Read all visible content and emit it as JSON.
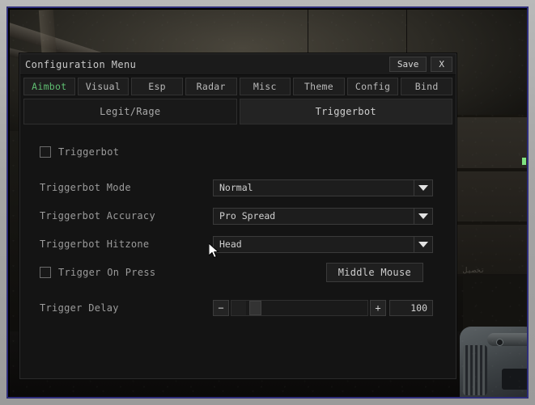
{
  "window": {
    "title": "Configuration Menu",
    "save_label": "Save",
    "close_label": "X"
  },
  "tabs": [
    {
      "label": "Aimbot",
      "active": true
    },
    {
      "label": "Visual",
      "active": false
    },
    {
      "label": "Esp",
      "active": false
    },
    {
      "label": "Radar",
      "active": false
    },
    {
      "label": "Misc",
      "active": false
    },
    {
      "label": "Theme",
      "active": false
    },
    {
      "label": "Config",
      "active": false
    },
    {
      "label": "Bind",
      "active": false
    }
  ],
  "subtabs": [
    {
      "label": "Legit/Rage",
      "active": false
    },
    {
      "label": "Triggerbot",
      "active": true
    }
  ],
  "settings": {
    "triggerbot_toggle": {
      "label": "Triggerbot",
      "checked": false
    },
    "mode": {
      "label": "Triggerbot Mode",
      "value": "Normal"
    },
    "accuracy": {
      "label": "Triggerbot Accuracy",
      "value": "Pro Spread"
    },
    "hitzone": {
      "label": "Triggerbot Hitzone",
      "value": "Head"
    },
    "trigger_on_press": {
      "label": "Trigger On Press",
      "checked": false,
      "keybind": "Middle Mouse"
    },
    "trigger_delay": {
      "label": "Trigger Delay",
      "value": "100",
      "minus_label": "−",
      "plus_label": "+",
      "fill_percent": 11,
      "handle_percent": 13
    }
  },
  "colors": {
    "panel_bg": "#141414",
    "accent_active_tab": "#5fbf72",
    "text_primary": "#cfcfcf",
    "text_label": "#9b9b9b",
    "frame_navy": "#2e2e7a",
    "frame_gray": "#b9b9b9"
  },
  "background": {
    "scene_note": "dark industrial game scene",
    "arabic_text": "تخصيل"
  }
}
